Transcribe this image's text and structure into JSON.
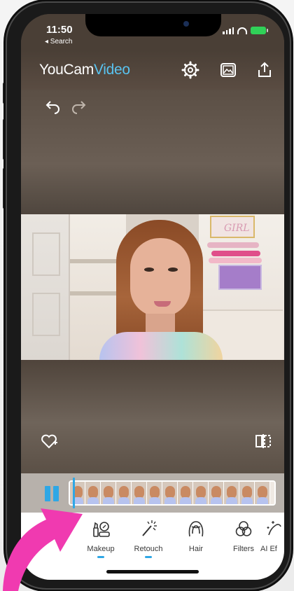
{
  "status_bar": {
    "time": "11:50",
    "back_label": "◂ Search"
  },
  "header": {
    "brand_you": "YouCam",
    "brand_video": "Video",
    "icons": [
      "settings-gear-icon",
      "gallery-icon",
      "share-upload-icon"
    ]
  },
  "toolbar": {
    "undo_icon": "undo-arrow-icon",
    "redo_icon": "redo-arrow-icon"
  },
  "video": {
    "sign_text": "GIRL"
  },
  "timeline": {
    "frame_count": 12,
    "state": "paused"
  },
  "tools": [
    {
      "label": "Makeup",
      "icon": "makeup-icon",
      "selected": true
    },
    {
      "label": "Retouch",
      "icon": "retouch-wand-icon",
      "selected": true
    },
    {
      "label": "Hair",
      "icon": "hair-icon",
      "selected": false
    },
    {
      "label": "Filters",
      "icon": "filters-icon",
      "selected": false
    },
    {
      "label": "AI Ef",
      "icon": "ai-effects-icon",
      "selected": false
    }
  ],
  "colors": {
    "accent": "#2fa7e5",
    "brand_video": "#59c3f0",
    "arrow": "#f03ab0"
  }
}
